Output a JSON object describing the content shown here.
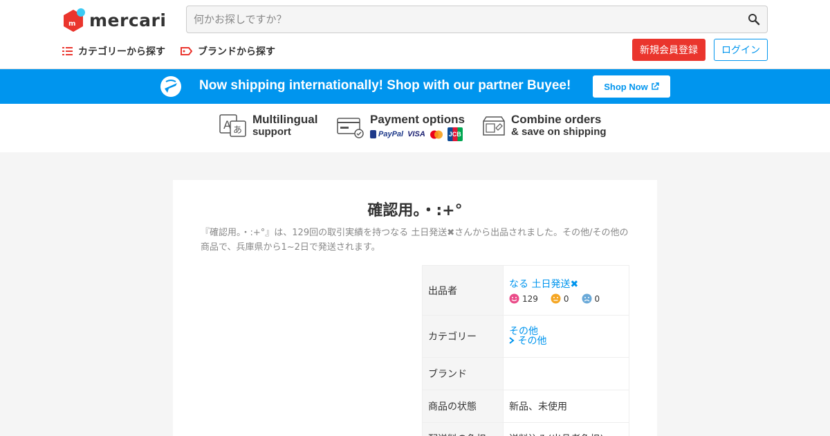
{
  "header": {
    "logo_text": "mercari",
    "search_placeholder": "何かお探しですか？",
    "nav": {
      "category": "カテゴリーから探す",
      "brand": "ブランドから探す"
    },
    "register_label": "新規会員登録",
    "login_label": "ログイン"
  },
  "banner": {
    "text": "Now shipping internationally! Shop with our partner Buyee!",
    "button": "Shop Now"
  },
  "features": {
    "multilingual": {
      "line1": "Multilingual",
      "line2": "support"
    },
    "payment": {
      "line1": "Payment options",
      "paypal": "PayPal",
      "visa": "VISA",
      "jcb": "JCB"
    },
    "combine": {
      "line1": "Combine orders",
      "line2": "& save on shipping"
    }
  },
  "product": {
    "title": "確認用。・:+°",
    "description": "『確認用。・:+°』は、129回の取引実績を持つなる 土日発送✖︎さんから出品されました。その他/その他の商品で、兵庫県から1~2日で発送されます。",
    "info": {
      "seller_label": "出品者",
      "seller_name": "なる 土日発送✖︎",
      "rating_good": "129",
      "rating_normal": "0",
      "rating_bad": "0",
      "category_label": "カテゴリー",
      "category_1": "その他",
      "category_2": "その他",
      "brand_label": "ブランド",
      "brand_value": "",
      "condition_label": "商品の状態",
      "condition_value": "新品、未使用",
      "shipping_label": "配送料の負担",
      "shipping_value": "送料込み(出品者負担)"
    }
  },
  "colors": {
    "brand_red": "#ea352d",
    "accent_blue": "#0095ee"
  }
}
